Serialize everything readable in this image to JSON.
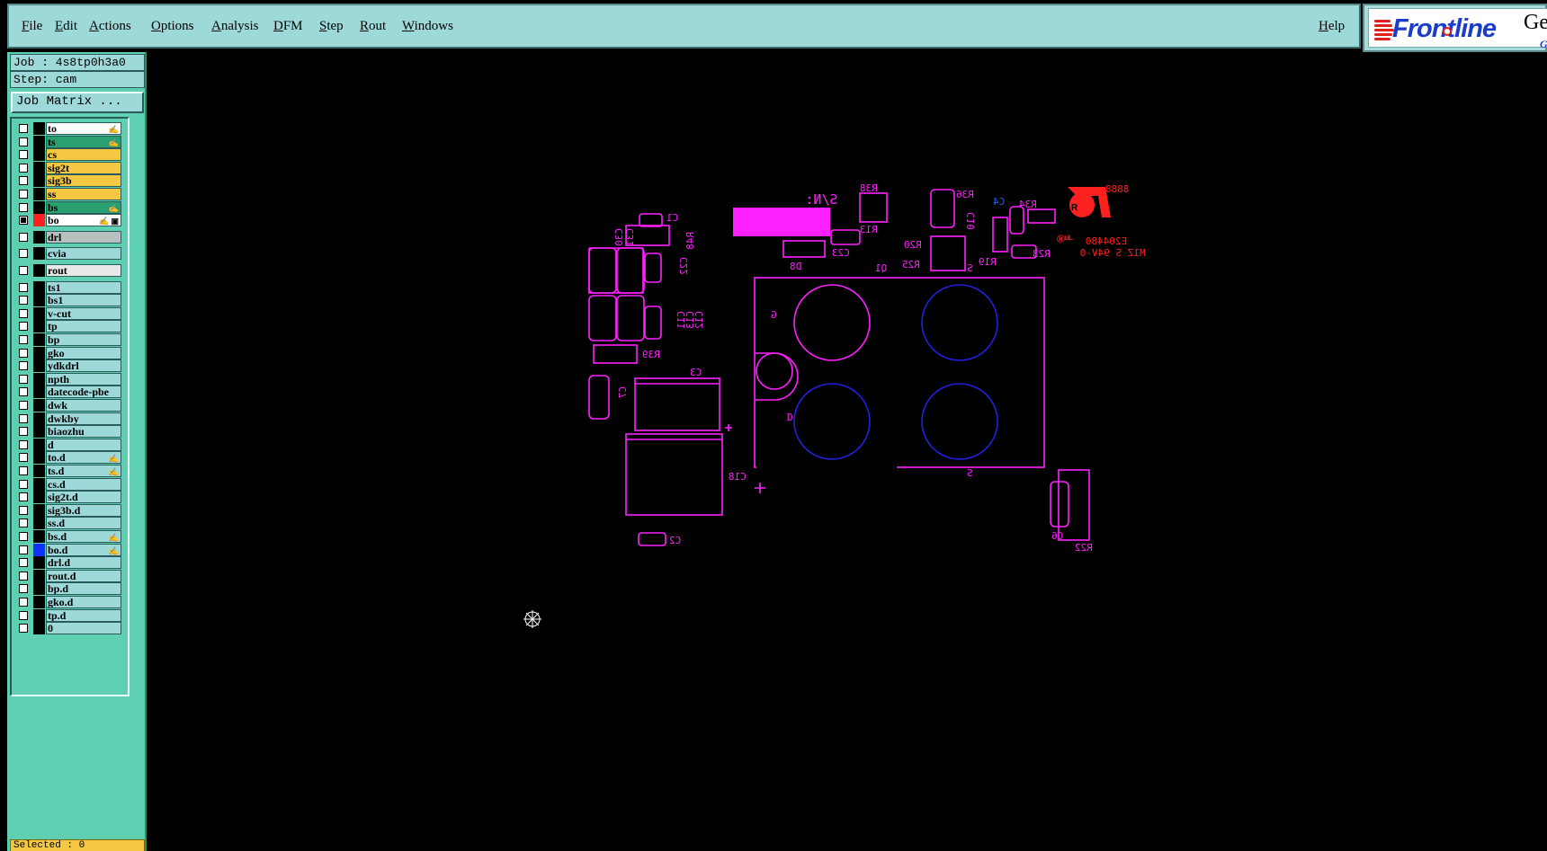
{
  "menu": {
    "items": [
      "File",
      "Edit",
      "Actions",
      "Options",
      "Analysis",
      "DFM",
      "Step",
      "Rout",
      "Windows"
    ],
    "help": "Help"
  },
  "logo": {
    "brand": "Frontline",
    "product": "Gen",
    "sub": "Gr"
  },
  "job": {
    "label": "Job : 4s8tp0h3a0",
    "step": "Step: cam",
    "matrix_button": "Job Matrix ..."
  },
  "layers": [
    {
      "name": "to",
      "bg": "#ffffff",
      "flag": "✍"
    },
    {
      "name": "ts",
      "bg": "#2aa070",
      "flag": "✍"
    },
    {
      "name": "cs",
      "bg": "#f5c842",
      "flag": ""
    },
    {
      "name": "sig2t",
      "bg": "#f5c842",
      "flag": ""
    },
    {
      "name": "sig3b",
      "bg": "#f5c842",
      "flag": ""
    },
    {
      "name": "ss",
      "bg": "#f5c842",
      "flag": ""
    },
    {
      "name": "bs",
      "bg": "#2aa070",
      "flag": "✍"
    },
    {
      "name": "bo",
      "bg": "#ffffff",
      "flag": "✍ ▣",
      "checked": true,
      "color": "#ff2020"
    },
    {
      "name": "drl",
      "bg": "#b8bfc0",
      "flag": "",
      "gap": true
    },
    {
      "name": "cvia",
      "bg": "#9ed9d9",
      "flag": "",
      "gap": true
    },
    {
      "name": "rout",
      "bg": "#e8e8e8",
      "flag": "",
      "gap": true
    },
    {
      "name": "ts1",
      "bg": "#9ed9d9",
      "flag": "",
      "gap": true
    },
    {
      "name": "bs1",
      "bg": "#9ed9d9",
      "flag": ""
    },
    {
      "name": "v-cut",
      "bg": "#9ed9d9",
      "flag": ""
    },
    {
      "name": "tp",
      "bg": "#9ed9d9",
      "flag": ""
    },
    {
      "name": "bp",
      "bg": "#9ed9d9",
      "flag": ""
    },
    {
      "name": "gko",
      "bg": "#9ed9d9",
      "flag": ""
    },
    {
      "name": "ydkdrl",
      "bg": "#9ed9d9",
      "flag": ""
    },
    {
      "name": "npth",
      "bg": "#9ed9d9",
      "flag": ""
    },
    {
      "name": "datecode-pbe",
      "bg": "#9ed9d9",
      "flag": ""
    },
    {
      "name": "dwk",
      "bg": "#9ed9d9",
      "flag": ""
    },
    {
      "name": "dwkby",
      "bg": "#9ed9d9",
      "flag": ""
    },
    {
      "name": "biaozhu",
      "bg": "#9ed9d9",
      "flag": ""
    },
    {
      "name": "d",
      "bg": "#9ed9d9",
      "flag": ""
    },
    {
      "name": "to.d",
      "bg": "#9ed9d9",
      "flag": "✍"
    },
    {
      "name": "ts.d",
      "bg": "#9ed9d9",
      "flag": "✍"
    },
    {
      "name": "cs.d",
      "bg": "#9ed9d9",
      "flag": ""
    },
    {
      "name": "sig2t.d",
      "bg": "#9ed9d9",
      "flag": ""
    },
    {
      "name": "sig3b.d",
      "bg": "#9ed9d9",
      "flag": ""
    },
    {
      "name": "ss.d",
      "bg": "#9ed9d9",
      "flag": ""
    },
    {
      "name": "bs.d",
      "bg": "#9ed9d9",
      "flag": "✍"
    },
    {
      "name": "bo.d",
      "bg": "#9ed9d9",
      "flag": "✍",
      "color": "#1030ff"
    },
    {
      "name": "drl.d",
      "bg": "#9ed9d9",
      "flag": ""
    },
    {
      "name": "rout.d",
      "bg": "#9ed9d9",
      "flag": ""
    },
    {
      "name": "bp.d",
      "bg": "#9ed9d9",
      "flag": ""
    },
    {
      "name": "gko.d",
      "bg": "#9ed9d9",
      "flag": ""
    },
    {
      "name": "tp.d",
      "bg": "#9ed9d9",
      "flag": ""
    },
    {
      "name": "0",
      "bg": "#9ed9d9",
      "flag": ""
    }
  ],
  "status": {
    "selected": "Selected : 0"
  },
  "colors": {
    "silk": "#ff20ff",
    "blue": "#2020e0",
    "logo_red": "#ff2020"
  },
  "pcb_labels": {
    "c1": "C1",
    "c30": "C30",
    "c31": "C31",
    "r48": "R48",
    "c22": "C22",
    "c11": "C11",
    "c13": "C13",
    "c12": "C12",
    "r39": "R39",
    "c3": "C3",
    "c7": "C7",
    "c18": "C18",
    "c2": "C2",
    "d8": "D8",
    "c23": "C23",
    "sn": "S/N:",
    "r38": "R38",
    "r13": "R13",
    "q1": "Q1",
    "r20": "R20",
    "r25": "R25",
    "r36": "R36",
    "c10": "C10",
    "r19": "R19",
    "c4": "C4",
    "r34": "R34",
    "r23": "R23",
    "s_mark": "S",
    "g": "G",
    "d": "D",
    "s_bottom": "S",
    "c6": "C6",
    "r22": "R22",
    "e_code": "E204480",
    "m_code": "M1Z S 94V-0",
    "date_code": "8888",
    "plus": "+"
  }
}
